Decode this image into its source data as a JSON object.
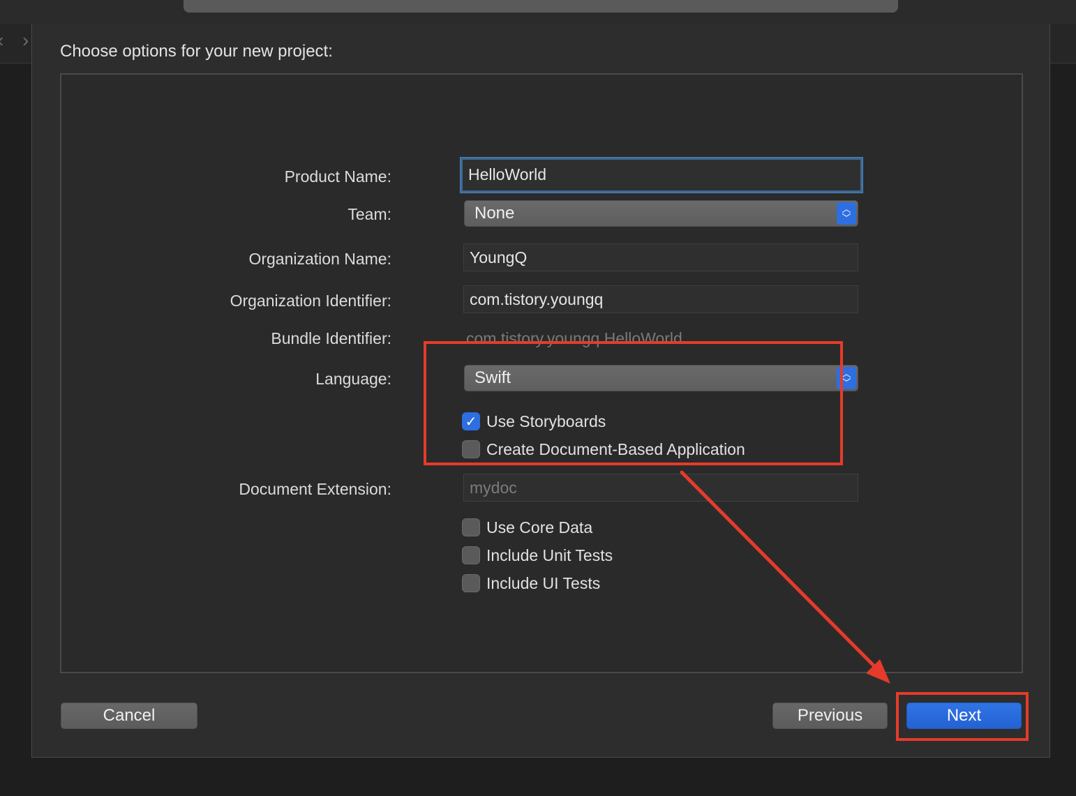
{
  "dialog": {
    "title": "Choose options for your new project:"
  },
  "form": {
    "product_name": {
      "label": "Product Name:",
      "value": "HelloWorld"
    },
    "team": {
      "label": "Team:",
      "value": "None"
    },
    "organization_name": {
      "label": "Organization Name:",
      "value": "YoungQ"
    },
    "organization_identifier": {
      "label": "Organization Identifier:",
      "value": "com.tistory.youngq"
    },
    "bundle_identifier": {
      "label": "Bundle Identifier:",
      "value": "com.tistory.youngq.HelloWorld"
    },
    "language": {
      "label": "Language:",
      "value": "Swift"
    },
    "use_storyboards": {
      "label": "Use Storyboards",
      "checked": true
    },
    "create_document_based": {
      "label": "Create Document-Based Application",
      "checked": false
    },
    "document_extension": {
      "label": "Document Extension:",
      "placeholder": "mydoc"
    },
    "use_core_data": {
      "label": "Use Core Data",
      "checked": false
    },
    "include_unit_tests": {
      "label": "Include Unit Tests",
      "checked": false
    },
    "include_ui_tests": {
      "label": "Include UI Tests",
      "checked": false
    }
  },
  "buttons": {
    "cancel": "Cancel",
    "previous": "Previous",
    "next": "Next"
  },
  "colors": {
    "accent": "#2d6fe0",
    "annotation": "#e63b2a"
  }
}
